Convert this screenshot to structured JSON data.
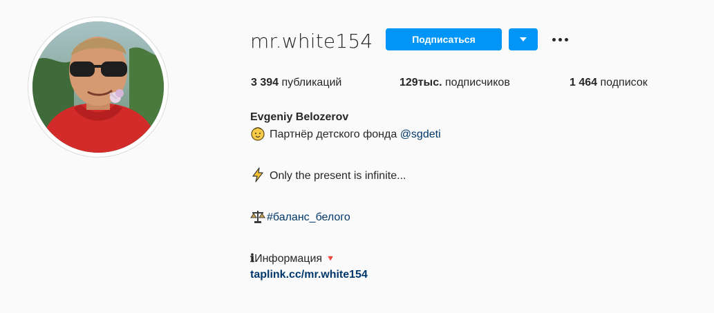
{
  "profile": {
    "username": "mr.white154",
    "follow_label": "Подписаться",
    "dropdown_icon": "caret-down-icon",
    "more_icon": "more-options-icon",
    "accent_color": "#0095f6",
    "link_color": "#00376b"
  },
  "stats": {
    "posts_count": "3 394",
    "posts_label": "публикаций",
    "followers_count": "129тыс.",
    "followers_label": "подписчиков",
    "following_count": "1 464",
    "following_label": "подписок"
  },
  "bio": {
    "full_name": "Evgeniy Belozerov",
    "line1_icon": "baby-face-emoji",
    "line1_text": "Партнёр детского фонда ",
    "line1_mention": "@sgdeti",
    "line2_icon": "lightning-emoji",
    "line2_text": "Only the present is infinite...",
    "line3_icon": "scales-emoji",
    "line3_hashtag": "#баланс_белого",
    "line4_prefix": "ℹ",
    "line4_text": "Информация ",
    "line4_suffix": "🔻",
    "website": "taplink.cc/mr.white154"
  }
}
